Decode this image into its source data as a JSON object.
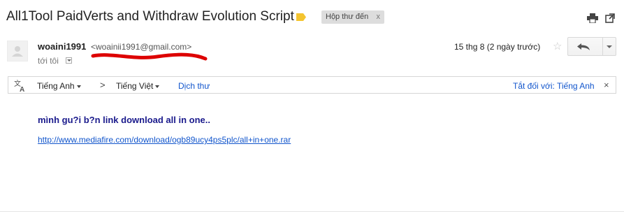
{
  "email": {
    "subject": "All1Tool PaidVerts and Withdraw Evolution Script",
    "label_chip": {
      "text": "Hộp thư đến",
      "close": "x"
    },
    "sender": {
      "name": "woaini1991",
      "email": "<woainii1991@gmail.com>"
    },
    "recipient": "tới tôi",
    "date": "15 thg 8 (2 ngày trước)"
  },
  "translate_bar": {
    "source_lang": "Tiếng Anh",
    "arrow": ">",
    "target_lang": "Tiếng Việt",
    "translate_link": "Dịch thư",
    "turn_off": "Tắt đối với: Tiếng Anh",
    "close": "×"
  },
  "body": {
    "line1": "mình gu?i b?n link download all in one..",
    "link": "http://www.mediafire.com/download/ogb89ucy4ps5plc/all+in+one.rar"
  },
  "icons": {
    "label_tag": "label-tag-icon",
    "print": "print-icon",
    "popout": "new-window-icon",
    "star": "star-icon",
    "reply": "reply-icon",
    "translate": "translate-icon"
  },
  "colors": {
    "label_tag": "#f4c430",
    "link": "#1155cc",
    "redaction": "#dd0000"
  }
}
